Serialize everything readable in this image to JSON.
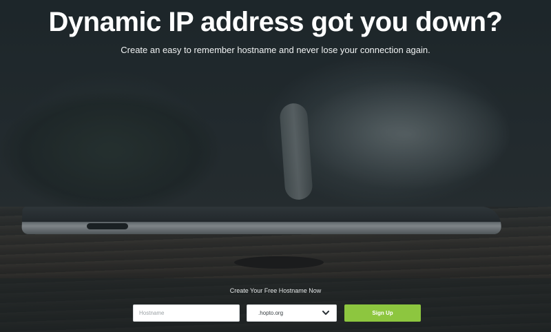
{
  "hero": {
    "title": "Dynamic IP address got you down?",
    "subtitle": "Create an easy to remember hostname and never lose your connection again."
  },
  "signup": {
    "caption": "Create Your Free Hostname Now",
    "hostname_placeholder": "Hostname",
    "hostname_value": "",
    "domain_selected": ".hopto.org",
    "button_label": "Sign Up",
    "accent_color": "#8dc63f"
  },
  "icons": {
    "domain_dropdown": "chevron-down-icon"
  }
}
